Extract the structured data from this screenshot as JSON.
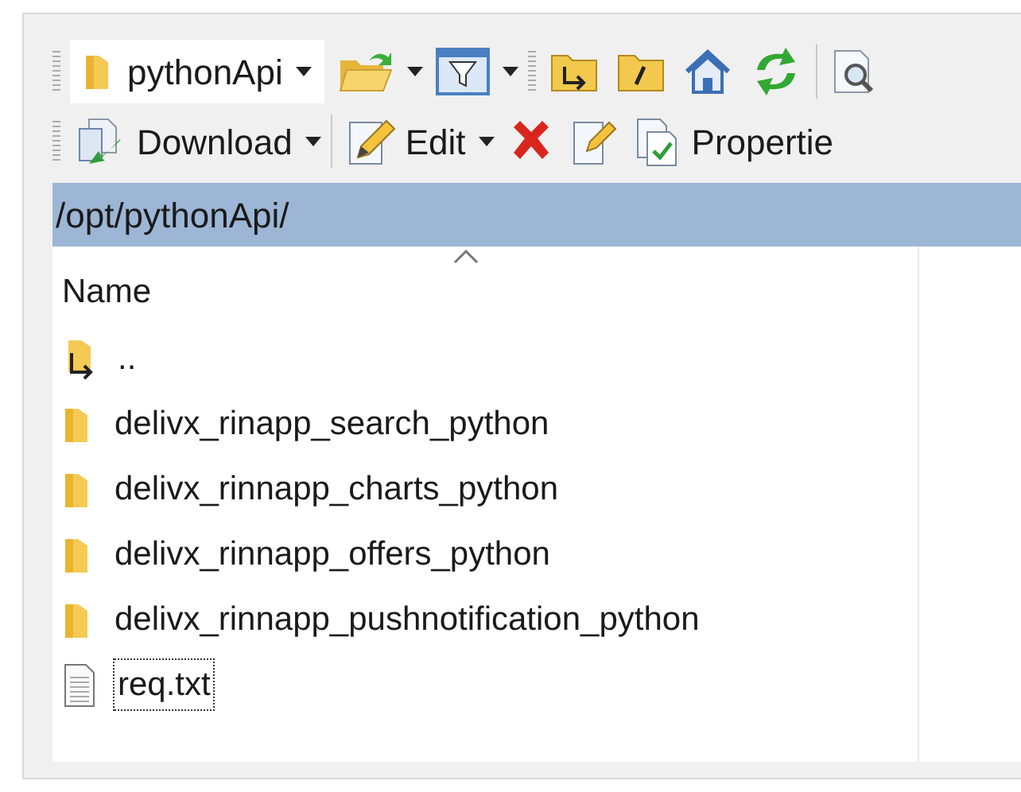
{
  "toolbar_top": {
    "location": "pythonApi",
    "buttons": [
      {
        "kind": "open",
        "dropdown": true
      },
      {
        "kind": "filter",
        "dropdown": true
      },
      {
        "kind": "parent",
        "dropdown": false
      },
      {
        "kind": "root",
        "dropdown": false
      },
      {
        "kind": "home",
        "dropdown": false
      },
      {
        "kind": "refresh",
        "dropdown": false
      },
      {
        "kind": "find",
        "dropdown": false
      }
    ]
  },
  "toolbar_bottom": {
    "buttons": [
      {
        "kind": "download",
        "label": "Download",
        "dropdown": true
      },
      {
        "kind": "edit",
        "label": "Edit",
        "dropdown": true
      },
      {
        "kind": "delete",
        "dropdown": false
      },
      {
        "kind": "rename",
        "dropdown": false
      },
      {
        "kind": "properties",
        "label": "Propertie",
        "dropdown": false
      }
    ]
  },
  "path": "/opt/pythonApi/",
  "file_list": {
    "columns": [
      {
        "label": "Name",
        "sort_ascending": true
      }
    ],
    "rows": [
      {
        "name": "..",
        "kind": "parent",
        "focused": false
      },
      {
        "name": "delivx_rinapp_search_python",
        "kind": "folder",
        "focused": false
      },
      {
        "name": "delivx_rinnapp_charts_python",
        "kind": "folder",
        "focused": false
      },
      {
        "name": "delivx_rinnapp_offers_python",
        "kind": "folder",
        "focused": false
      },
      {
        "name": "delivx_rinnapp_pushnotification_python",
        "kind": "folder",
        "focused": false
      },
      {
        "name": "req.txt",
        "kind": "file",
        "focused": true
      }
    ]
  }
}
